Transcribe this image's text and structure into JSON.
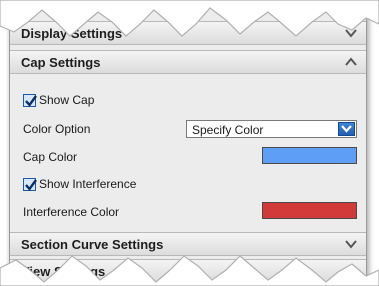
{
  "sections": {
    "display": {
      "title": "Display Settings",
      "expanded": false
    },
    "cap": {
      "title": "Cap Settings",
      "expanded": true
    },
    "section_curve": {
      "title": "Section Curve Settings",
      "expanded": false
    },
    "view": {
      "title": "View Settings",
      "expanded": false
    }
  },
  "cap": {
    "show_cap": {
      "label": "Show Cap",
      "checked": true
    },
    "color_option": {
      "label": "Color Option",
      "value": "Specify Color"
    },
    "cap_color": {
      "label": "Cap Color",
      "color": "#5f9ef7"
    },
    "show_interference": {
      "label": "Show Interference",
      "checked": true
    },
    "interference_color": {
      "label": "Interference Color",
      "color": "#d23a3a"
    }
  }
}
